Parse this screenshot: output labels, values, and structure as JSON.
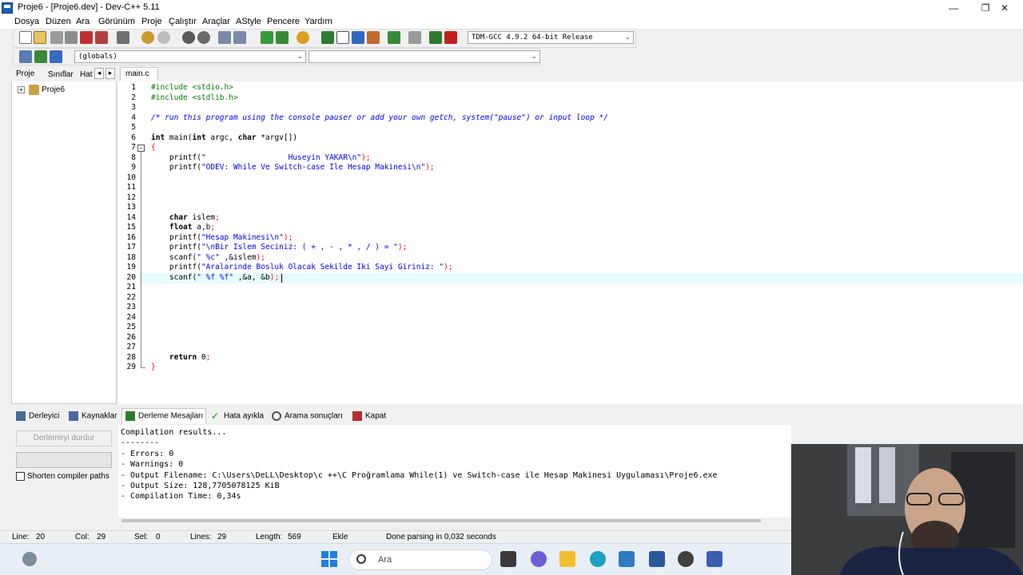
{
  "window": {
    "title": "Proje6 - [Proje6.dev] - Dev-C++ 5.11",
    "minimize": "—",
    "maximize": "❐",
    "close": "✕"
  },
  "menu": [
    "Dosya",
    "Düzen",
    "Ara",
    "Görünüm",
    "Proje",
    "Çalıştır",
    "Araçlar",
    "AStyle",
    "Pencere",
    "Yardım"
  ],
  "toolbar": {
    "compiler": "TDM-GCC 4.9.2 64-bit Release",
    "scope": "(globals)",
    "function": ""
  },
  "left_panel": {
    "tabs": [
      "Proje",
      "Sınıflar",
      "Hat"
    ],
    "nav_prev": "◂",
    "nav_next": "▸",
    "project": "Proje6",
    "expand": "+"
  },
  "editor": {
    "tab": "main.c",
    "lines": [
      {
        "n": "1",
        "segs": [
          {
            "t": "#include <stdio.h>",
            "c": "pp"
          }
        ]
      },
      {
        "n": "2",
        "segs": [
          {
            "t": "#include <stdlib.h>",
            "c": "pp"
          }
        ]
      },
      {
        "n": "3",
        "segs": []
      },
      {
        "n": "4",
        "segs": [
          {
            "t": "/* run this program using the console pauser or add your own getch, system(\"pause\") or input loop */",
            "c": "cm"
          }
        ]
      },
      {
        "n": "5",
        "segs": []
      },
      {
        "n": "6",
        "segs": [
          {
            "t": "int",
            "c": "kw"
          },
          {
            "t": " main(",
            "c": ""
          },
          {
            "t": "int",
            "c": "kw"
          },
          {
            "t": " argc, ",
            "c": ""
          },
          {
            "t": "char",
            "c": "kw"
          },
          {
            "t": " *argv[])",
            "c": ""
          }
        ]
      },
      {
        "n": "7",
        "segs": [
          {
            "t": "{",
            "c": "sym"
          }
        ]
      },
      {
        "n": "8",
        "segs": [
          {
            "t": "    printf(",
            "c": ""
          },
          {
            "t": "\"                  Huseyin YAKAR\\n\"",
            "c": "st"
          },
          {
            "t": ");",
            "c": "sym"
          }
        ]
      },
      {
        "n": "9",
        "segs": [
          {
            "t": "    printf(",
            "c": ""
          },
          {
            "t": "\"ODEV: While Ve Switch-case Ile Hesap Makinesi\\n\"",
            "c": "st"
          },
          {
            "t": ");",
            "c": "sym"
          }
        ]
      },
      {
        "n": "10",
        "segs": []
      },
      {
        "n": "11",
        "segs": []
      },
      {
        "n": "12",
        "segs": []
      },
      {
        "n": "13",
        "segs": []
      },
      {
        "n": "14",
        "segs": [
          {
            "t": "    char",
            "c": "kw"
          },
          {
            "t": " islem",
            "c": ""
          },
          {
            "t": ";",
            "c": "sym"
          }
        ]
      },
      {
        "n": "15",
        "segs": [
          {
            "t": "    float",
            "c": "kw"
          },
          {
            "t": " a,b",
            "c": ""
          },
          {
            "t": ";",
            "c": "sym"
          }
        ]
      },
      {
        "n": "16",
        "segs": [
          {
            "t": "    printf(",
            "c": ""
          },
          {
            "t": "\"Hesap Makinesi\\n\"",
            "c": "st"
          },
          {
            "t": ");",
            "c": "sym"
          }
        ]
      },
      {
        "n": "17",
        "segs": [
          {
            "t": "    printf(",
            "c": ""
          },
          {
            "t": "\"\\nBir Islem Seciniz: ( + , - , * , / ) = \"",
            "c": "st"
          },
          {
            "t": ");",
            "c": "sym"
          }
        ]
      },
      {
        "n": "18",
        "segs": [
          {
            "t": "    scanf(",
            "c": ""
          },
          {
            "t": "\" %c\"",
            "c": "st"
          },
          {
            "t": " ,&islem",
            "c": ""
          },
          {
            "t": ");",
            "c": "sym"
          }
        ]
      },
      {
        "n": "19",
        "segs": [
          {
            "t": "    printf(",
            "c": ""
          },
          {
            "t": "\"Aralarinde Bosluk Olacak Sekilde Iki Sayi Giriniz: \"",
            "c": "st"
          },
          {
            "t": ");",
            "c": "sym"
          }
        ]
      },
      {
        "n": "20",
        "segs": [
          {
            "t": "    scanf(",
            "c": ""
          },
          {
            "t": "\" %f %f\"",
            "c": "st"
          },
          {
            "t": " ,&a, &b",
            "c": ""
          },
          {
            "t": ");",
            "c": "sym"
          }
        ]
      },
      {
        "n": "21",
        "segs": []
      },
      {
        "n": "22",
        "segs": []
      },
      {
        "n": "23",
        "segs": []
      },
      {
        "n": "24",
        "segs": []
      },
      {
        "n": "25",
        "segs": []
      },
      {
        "n": "26",
        "segs": []
      },
      {
        "n": "27",
        "segs": []
      },
      {
        "n": "28",
        "segs": [
          {
            "t": "    return",
            "c": "kw"
          },
          {
            "t": " 0",
            "c": ""
          },
          {
            "t": ";",
            "c": "sym"
          }
        ]
      },
      {
        "n": "29",
        "segs": [
          {
            "t": "}",
            "c": "sym"
          }
        ]
      }
    ]
  },
  "bottom_tabs": [
    "Derleyici",
    "Kaynaklar",
    "Derleme Mesajları",
    "Hata ayıkla",
    "Arama sonuçları",
    "Kapat"
  ],
  "compile_panel": {
    "stop_button": "Derlemeyi durdur",
    "shorten_label": "Shorten compiler paths"
  },
  "output_lines": [
    "Compilation results...",
    "--------",
    "- Errors: 0",
    "- Warnings: 0",
    "- Output Filename: C:\\Users\\DeLL\\Desktop\\c ++\\C Proğramlama While(1) ve Switch-case ile Hesap Makinesi Uygulaması\\Proje6.exe",
    "- Output Size: 128,7705078125 KiB",
    "- Compilation Time: 0,34s"
  ],
  "status": {
    "line_label": "Line:",
    "line": "20",
    "col_label": "Col:",
    "col": "29",
    "sel_label": "Sel:",
    "sel": "0",
    "lines_label": "Lines:",
    "lines": "29",
    "length_label": "Length:",
    "length": "569",
    "mode": "Ekle",
    "message": "Done parsing in 0,032 seconds"
  },
  "taskbar": {
    "search_placeholder": "Ara"
  },
  "colors": {
    "keyword": "#000000",
    "preprocessor": "#008000",
    "string": "#0000ff",
    "symbol": "#ff0000",
    "current_line": "#e6fcfc"
  }
}
